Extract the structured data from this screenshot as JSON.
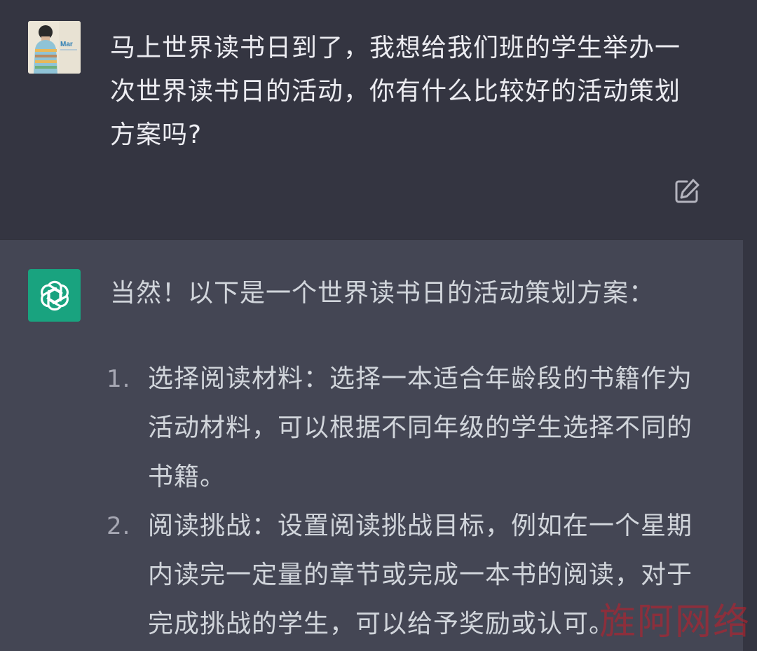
{
  "user_message": {
    "avatar_icon": "user-photo-avatar",
    "avatar_caption": "Mar",
    "text": "马上世界读书日到了，我想给我们班的学生举办一次世界读书日的活动，你有什么比较好的活动策划方案吗?",
    "edit_icon": "edit-icon"
  },
  "assistant_message": {
    "avatar_icon": "openai-logo-icon",
    "intro": "当然！以下是一个世界读书日的活动策划方案：",
    "items": [
      {
        "number": "1.",
        "text": "选择阅读材料：选择一本适合年龄段的书籍作为活动材料，可以根据不同年级的学生选择不同的书籍。"
      },
      {
        "number": "2.",
        "text": "阅读挑战：设置阅读挑战目标，例如在一个星期内读完一定量的章节或完成一本书的阅读，对于完成挑战的学生，可以给予奖励或认可。"
      }
    ]
  },
  "watermark": "旌阿网络",
  "colors": {
    "user_bg": "#343541",
    "assistant_bg": "#444654",
    "bot_avatar": "#19a37f",
    "text": "#ececf1",
    "watermark": "#c81e28"
  }
}
